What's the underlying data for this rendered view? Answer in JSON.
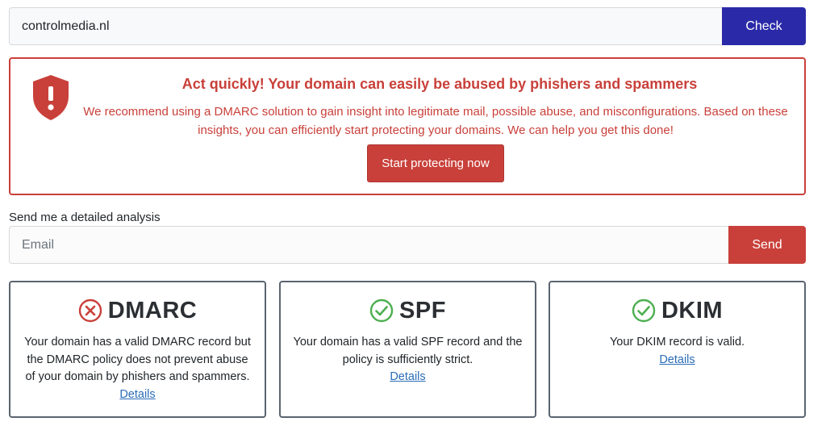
{
  "domain_check": {
    "value": "controlmedia.nl",
    "button_label": "Check"
  },
  "alert": {
    "title": "Act quickly! Your domain can easily be abused by phishers and spammers",
    "text": "We recommend using a DMARC solution to gain insight into legitimate mail, possible abuse, and misconfigurations. Based on these insights, you can efficiently start protecting your domains. We can help you get this done!",
    "button_label": "Start protecting now",
    "icon": "shield-exclamation-icon",
    "color": "#c9403a"
  },
  "analysis": {
    "label": "Send me a detailed analysis",
    "email_placeholder": "Email",
    "button_label": "Send"
  },
  "cards": [
    {
      "title": "DMARC",
      "status": "fail",
      "icon": "x-circle-icon",
      "text": "Your domain has a valid DMARC record but the DMARC policy does not prevent abuse of your domain by phishers and spammers.",
      "link": "Details"
    },
    {
      "title": "SPF",
      "status": "pass",
      "icon": "check-circle-icon",
      "text": "Your domain has a valid SPF record and the policy is sufficiently strict.",
      "link": "Details"
    },
    {
      "title": "DKIM",
      "status": "pass",
      "icon": "check-circle-icon",
      "text": "Your DKIM record is valid.",
      "link": "Details"
    }
  ],
  "colors": {
    "primary": "#2a2aa8",
    "danger": "#c9403a",
    "success": "#4caf50",
    "link": "#2a6db8"
  }
}
